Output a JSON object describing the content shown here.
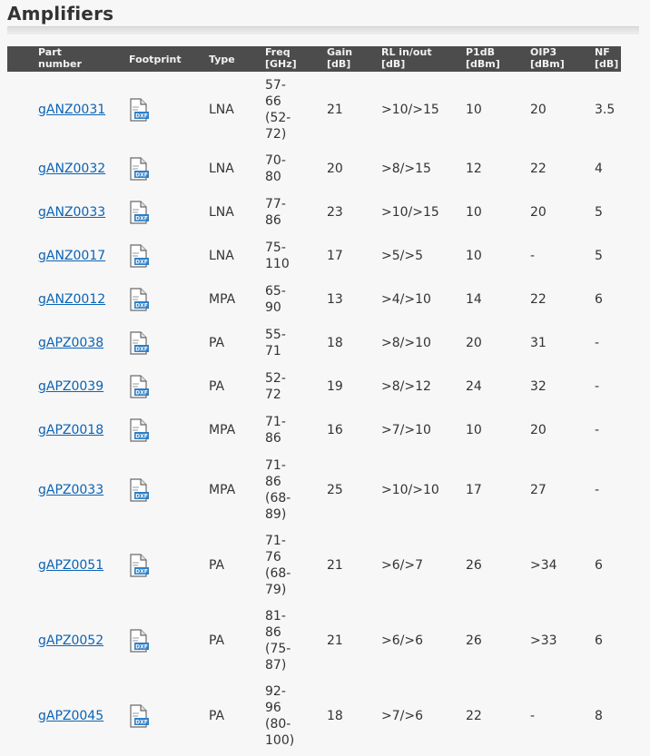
{
  "page": {
    "title": "Amplifiers"
  },
  "table": {
    "columns": [
      {
        "key": "part",
        "lines": [
          "Part",
          "number"
        ]
      },
      {
        "key": "footprint",
        "lines": [
          "Footprint"
        ]
      },
      {
        "key": "type",
        "lines": [
          "Type"
        ]
      },
      {
        "key": "freq",
        "lines": [
          "Freq",
          "[GHz]"
        ]
      },
      {
        "key": "gain",
        "lines": [
          "Gain",
          "[dB]"
        ]
      },
      {
        "key": "rl",
        "lines": [
          "RL in/out",
          "[dB]"
        ]
      },
      {
        "key": "p1db",
        "lines": [
          "P1dB",
          "[dBm]"
        ]
      },
      {
        "key": "oip3",
        "lines": [
          "OIP3",
          "[dBm]"
        ]
      },
      {
        "key": "nf",
        "lines": [
          "NF",
          "[dB]"
        ]
      }
    ],
    "footprint_icon": {
      "name": "dxf-file-icon",
      "label": "DXF"
    },
    "rows": [
      {
        "part": "gANZ0031",
        "type": "LNA",
        "freq": [
          "57-",
          "66",
          "(52-",
          "72)"
        ],
        "gain": "21",
        "rl": ">10/>15",
        "p1db": "10",
        "oip3": "20",
        "nf": "3.5"
      },
      {
        "part": "gANZ0032",
        "type": "LNA",
        "freq": [
          "70-",
          "80"
        ],
        "gain": "20",
        "rl": ">8/>15",
        "p1db": "12",
        "oip3": "22",
        "nf": "4"
      },
      {
        "part": "gANZ0033",
        "type": "LNA",
        "freq": [
          "77-",
          "86"
        ],
        "gain": "23",
        "rl": ">10/>15",
        "p1db": "10",
        "oip3": "20",
        "nf": "5"
      },
      {
        "part": "gANZ0017",
        "type": "LNA",
        "freq": [
          "75-",
          "110"
        ],
        "gain": "17",
        "rl": ">5/>5",
        "p1db": "10",
        "oip3": "-",
        "nf": "5"
      },
      {
        "part": "gANZ0012",
        "type": "MPA",
        "freq": [
          "65-",
          "90"
        ],
        "gain": "13",
        "rl": ">4/>10",
        "p1db": "14",
        "oip3": "22",
        "nf": "6"
      },
      {
        "part": "gAPZ0038",
        "type": "PA",
        "freq": [
          "55-",
          "71"
        ],
        "gain": "18",
        "rl": ">8/>10",
        "p1db": "20",
        "oip3": "31",
        "nf": "-"
      },
      {
        "part": "gAPZ0039",
        "type": "PA",
        "freq": [
          "52-",
          "72"
        ],
        "gain": "19",
        "rl": ">8/>12",
        "p1db": "24",
        "oip3": "32",
        "nf": "-"
      },
      {
        "part": "gAPZ0018",
        "type": "MPA",
        "freq": [
          "71-",
          "86"
        ],
        "gain": "16",
        "rl": ">7/>10",
        "p1db": "10",
        "oip3": "20",
        "nf": "-"
      },
      {
        "part": "gAPZ0033",
        "type": "MPA",
        "freq": [
          "71-",
          "86",
          "(68-",
          "89)"
        ],
        "gain": "25",
        "rl": ">10/>10",
        "p1db": "17",
        "oip3": "27",
        "nf": "-"
      },
      {
        "part": "gAPZ0051",
        "type": "PA",
        "freq": [
          "71-",
          "76",
          "(68-",
          "79)"
        ],
        "gain": "21",
        "rl": ">6/>7",
        "p1db": "26",
        "oip3": ">34",
        "nf": "6"
      },
      {
        "part": "gAPZ0052",
        "type": "PA",
        "freq": [
          "81-",
          "86",
          "(75-",
          "87)"
        ],
        "gain": "21",
        "rl": ">6/>6",
        "p1db": "26",
        "oip3": ">33",
        "nf": "6"
      },
      {
        "part": "gAPZ0045",
        "type": "PA",
        "freq": [
          "92-",
          "96",
          "(80-",
          "100)"
        ],
        "gain": "18",
        "rl": ">7/>6",
        "p1db": "22",
        "oip3": "-",
        "nf": "8"
      }
    ]
  }
}
